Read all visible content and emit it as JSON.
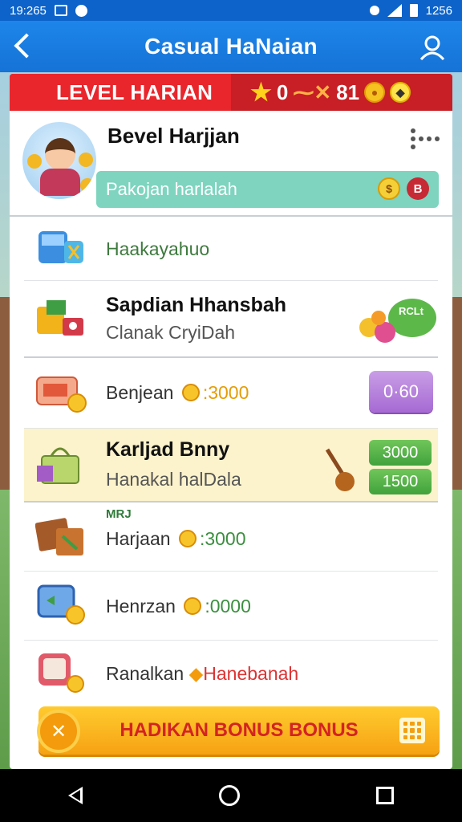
{
  "status": {
    "time": "19:265",
    "right_time": "1256"
  },
  "appbar": {
    "title": "Casual HaNaian"
  },
  "banner": {
    "level_label": "LEVEL HARIAN",
    "stat_a": "0",
    "stat_b": "81"
  },
  "profile": {
    "name": "Bevel Harjjan",
    "progress_text": "Pakojan harlalah"
  },
  "rows": [
    {
      "title": "Haakayahuo"
    },
    {
      "title": "Sapdian Hhansbah",
      "subtitle": "Clanak CryiDah",
      "tag": "RCLt"
    },
    {
      "title": "Benjean",
      "amount": ":3000",
      "button": "0·60"
    },
    {
      "title": "Karljad Bnny",
      "subtitle": "Hanakal halDala",
      "button_top": "3000",
      "button_bottom": "1500"
    },
    {
      "title": "Harjaan",
      "amount": ":3000",
      "label_above": "MRJ"
    },
    {
      "title": "Henrzan",
      "amount": ":0000"
    },
    {
      "title": "Ranalkan",
      "amount_text": "Hanebanah"
    }
  ],
  "bonus": {
    "label": "HADIKAN BONUS BONUS"
  },
  "colors": {
    "accent_blue": "#1672d6",
    "banner_red": "#e8262c",
    "bonus_orange": "#f6a212",
    "purple": "#a66ad3",
    "green": "#41a23c"
  }
}
